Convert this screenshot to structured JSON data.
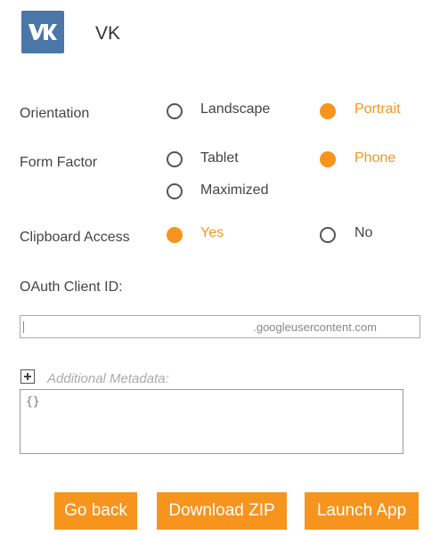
{
  "app": {
    "title": "VK",
    "icon": "vk-logo-icon",
    "brand_color": "#4a76a8"
  },
  "accent_color": "#f7941d",
  "form": {
    "orientation": {
      "label": "Orientation",
      "options": [
        {
          "label": "Landscape",
          "selected": false
        },
        {
          "label": "Portrait",
          "selected": true
        }
      ]
    },
    "form_factor": {
      "label": "Form Factor",
      "options": [
        {
          "label": "Tablet",
          "selected": false
        },
        {
          "label": "Phone",
          "selected": true
        },
        {
          "label": "Maximized",
          "selected": false
        }
      ]
    },
    "clipboard": {
      "label": "Clipboard Access",
      "options": [
        {
          "label": "Yes",
          "selected": true
        },
        {
          "label": "No",
          "selected": false
        }
      ]
    },
    "oauth": {
      "label": "OAuth Client ID:",
      "value": ".googleusercontent.com"
    },
    "metadata": {
      "label": "Additional Metadata:",
      "value": "{}"
    }
  },
  "buttons": {
    "back": "Go back",
    "download": "Download ZIP",
    "launch": "Launch App"
  }
}
